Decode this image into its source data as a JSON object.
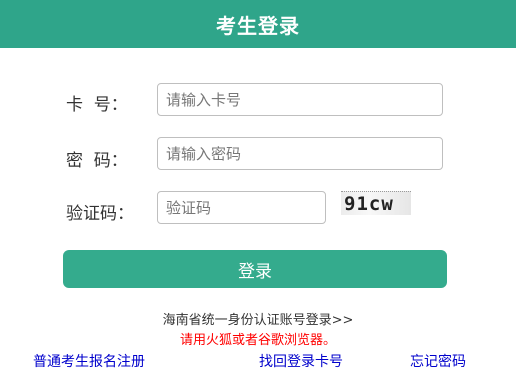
{
  "header": {
    "title": "考生登录"
  },
  "form": {
    "card_label": "卡  号：",
    "card_placeholder": "请输入卡号",
    "password_label": "密  码：",
    "password_placeholder": "请输入密码",
    "captcha_label": "验证码：",
    "captcha_placeholder": "验证码",
    "captcha_text": "91cw",
    "login_label": "登录"
  },
  "links": {
    "sso": "海南省统一身份认证账号登录>>",
    "browser_note": "请用火狐或者谷歌浏览器。",
    "register": "普通考生报名注册",
    "recover_card": "找回登录卡号",
    "forgot_password": "忘记密码"
  },
  "colors": {
    "header_bg": "#2fa58a",
    "button_bg": "#34ab8d",
    "note_text": "#ff0000",
    "link_text": "#0000cc"
  }
}
